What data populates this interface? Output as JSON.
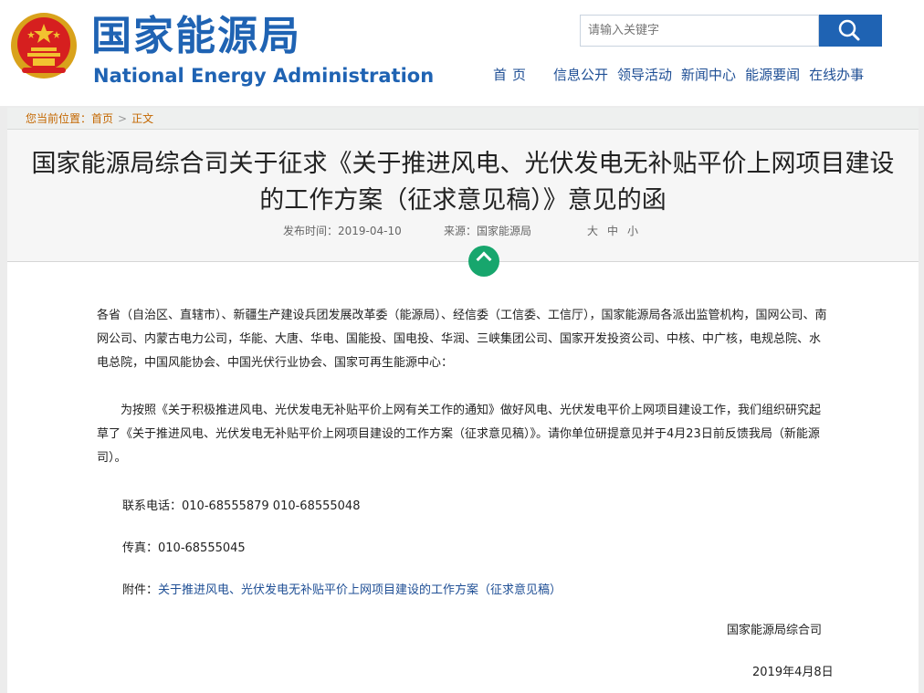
{
  "header": {
    "brand_cn": "国家能源局",
    "brand_en": "National Energy Administration",
    "search_placeholder": "请输入关键字",
    "nav": [
      "首页",
      "信息公开",
      "领导活动",
      "新闻中心",
      "能源要闻",
      "在线办事"
    ]
  },
  "breadcrumb": {
    "prefix": "您当前位置：",
    "home": "首页",
    "separator": ">",
    "current": "正文"
  },
  "article": {
    "title": "国家能源局综合司关于征求《关于推进风电、光伏发电无补贴平价上网项目建设的工作方案（征求意见稿）》意见的函",
    "date_label": "发布时间：2019-04-10",
    "source_label": "来源：国家能源局",
    "font_sizes": [
      "大",
      "中",
      "小"
    ],
    "para1": "各省（自治区、直辖市）、新疆生产建设兵团发展改革委（能源局）、经信委（工信委、工信厅），国家能源局各派出监管机构，国网公司、南网公司、内蒙古电力公司，华能、大唐、华电、国能投、国电投、华润、三峡集团公司、国家开发投资公司、中核、中广核，电规总院、水电总院，中国风能协会、中国光伏行业协会、国家可再生能源中心：",
    "para2": "为按照《关于积极推进风电、光伏发电无补贴平价上网有关工作的通知》做好风电、光伏发电平价上网项目建设工作，我们组织研究起草了《关于推进风电、光伏发电无补贴平价上网项目建设的工作方案（征求意见稿）》。请你单位研提意见并于4月23日前反馈我局（新能源司）。",
    "phone": "联系电话：010-68555879 010-68555048",
    "fax": "传真：010-68555045",
    "attachment_label": "附件：",
    "attachment_link": "关于推进风电、光伏发电无补贴平价上网项目建设的工作方案（征求意见稿）",
    "signature": "国家能源局综合司",
    "sign_date": "2019年4月8日"
  },
  "colors": {
    "brand_blue": "#1f63b3",
    "breadcrumb_orange": "#c46700",
    "toggle_green": "#17a66d"
  },
  "icons": {
    "emblem": "national-emblem-icon",
    "search": "search-icon",
    "toggle": "chevron-up-icon"
  }
}
